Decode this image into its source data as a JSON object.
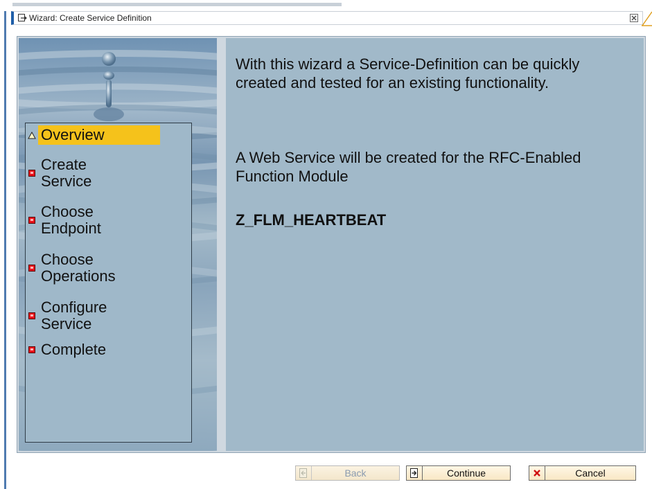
{
  "dialog": {
    "title": "Wizard: Create Service Definition",
    "close_glyph": "☒"
  },
  "steps": [
    {
      "label": "Overview",
      "status": "current",
      "icon": "warning-triangle-icon"
    },
    {
      "label": "Create Service",
      "status": "pending",
      "icon": "red-square-icon"
    },
    {
      "label": "Choose Endpoint",
      "status": "pending",
      "icon": "red-square-icon"
    },
    {
      "label": "Choose Operations",
      "status": "pending",
      "icon": "red-square-icon"
    },
    {
      "label": "Configure Service",
      "status": "pending",
      "icon": "red-square-icon"
    },
    {
      "label": "Complete",
      "status": "pending",
      "icon": "red-square-icon"
    }
  ],
  "content": {
    "intro": "With this wizard a Service-Definition can be quickly created and tested for an existing functionality.",
    "description": "A Web Service will be created for the RFC-Enabled Function Module",
    "function_module": "Z_FLM_HEARTBEAT"
  },
  "buttons": {
    "back": {
      "label": "Back",
      "enabled": false
    },
    "continue": {
      "label": "Continue",
      "enabled": true
    },
    "cancel": {
      "label": "Cancel",
      "enabled": true
    }
  },
  "colors": {
    "highlight": "#f5c21b",
    "panel": "#a1b9c9",
    "title_accent": "#1f5ea8",
    "pending_marker": "#e8111a"
  }
}
